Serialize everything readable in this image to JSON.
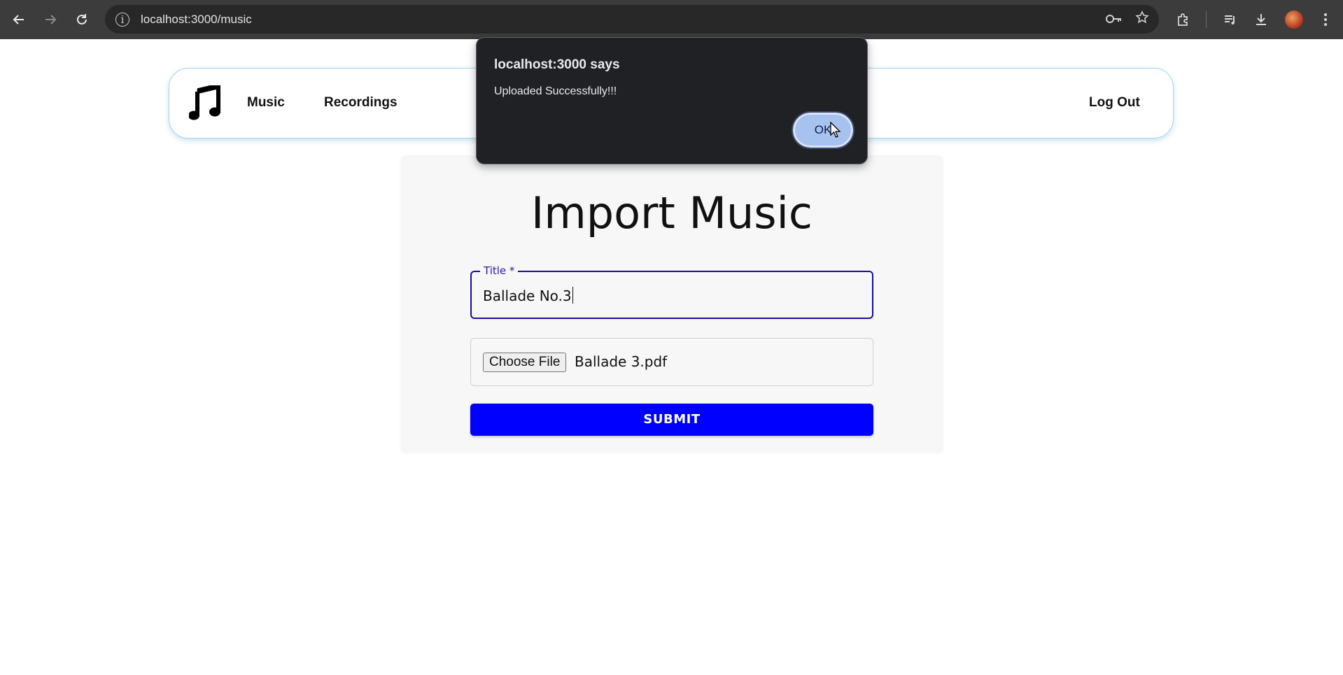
{
  "browser": {
    "url": "localhost:3000/music",
    "icons": [
      "back-icon",
      "forward-icon",
      "reload-icon",
      "site-info-icon",
      "password-key-icon",
      "bookmark-star-icon",
      "extensions-icon",
      "media-queue-icon",
      "download-icon",
      "profile-avatar",
      "menu-kebab-icon"
    ]
  },
  "navbar": {
    "links": [
      "Music",
      "Recordings"
    ],
    "logout": "Log Out",
    "logo_icon": "music-note-icon"
  },
  "form": {
    "heading": "Import Music",
    "title_label": "Title *",
    "title_value": "Ballade No.3",
    "file_button": "Choose File",
    "file_name": "Ballade 3.pdf",
    "submit_label": "SUBMIT"
  },
  "dialog": {
    "title": "localhost:3000 says",
    "message": "Uploaded Successfully!!!",
    "ok_label": "OK"
  },
  "colors": {
    "submit": "#0000ff",
    "field_focus": "#1a0d99",
    "navbar_border": "#a8d4e6"
  }
}
